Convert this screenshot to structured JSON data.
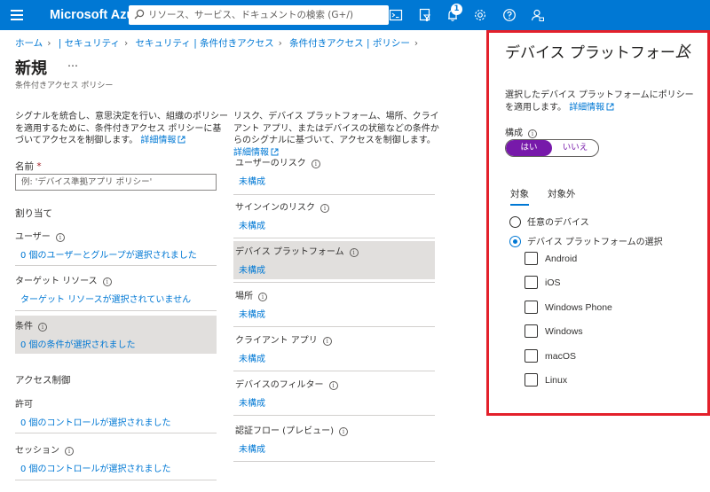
{
  "topbar": {
    "brand": "Microsoft Azure",
    "search_placeholder": "リソース、サービス、ドキュメントの検索 (G+/)",
    "notification_count": "1"
  },
  "breadcrumb": [
    "ホーム",
    "| セキュリティ",
    "セキュリティ | 条件付きアクセス",
    "条件付きアクセス | ポリシー"
  ],
  "page": {
    "title": "新規",
    "more": "…",
    "subtitle": "条件付きアクセス ポリシー"
  },
  "left": {
    "intro_text": "シグナルを統合し、意思決定を行い、組織のポリシーを適用するために、条件付きアクセス ポリシーに基づいてアクセスを制御します。",
    "intro_link": "詳細情報",
    "name_label": "名前",
    "name_required": "*",
    "name_placeholder": "例: 'デバイス準拠アプリ ポリシー'",
    "assignments_head": "割り当て",
    "users_label": "ユーザー",
    "users_value": "0 個のユーザーとグループが選択されました",
    "target_label": "ターゲット リソース",
    "target_value": "ターゲット リソースが選択されていません",
    "conditions_label": "条件",
    "conditions_value": "0 個の条件が選択されました",
    "access_head": "アクセス制御",
    "grant_label": "許可",
    "grant_value": "0 個のコントロールが選択されました",
    "session_label": "セッション",
    "session_value": "0 個のコントロールが選択されました"
  },
  "middle": {
    "intro_text": "リスク、デバイス プラットフォーム、場所、クライアント アプリ、またはデバイスの状態などの条件からのシグナルに基づいて、アクセスを制御します。",
    "intro_link": "詳細情報",
    "items": [
      {
        "label": "ユーザーのリスク",
        "value": "未構成"
      },
      {
        "label": "サインインのリスク",
        "value": "未構成"
      },
      {
        "label": "デバイス プラットフォーム",
        "value": "未構成"
      },
      {
        "label": "場所",
        "value": "未構成"
      },
      {
        "label": "クライアント アプリ",
        "value": "未構成"
      },
      {
        "label": "デバイスのフィルター",
        "value": "未構成"
      },
      {
        "label": "認証フロー (プレビュー)",
        "value": "未構成"
      }
    ]
  },
  "panel": {
    "title": "デバイス プラットフォーム",
    "description": "選択したデバイス プラットフォームにポリシーを適用します。",
    "link": "詳細情報",
    "configure_label": "構成",
    "toggle_on": "はい",
    "toggle_off": "いいえ",
    "tab_include": "対象",
    "tab_exclude": "対象外",
    "radio_any": "任意のデバイス",
    "radio_select": "デバイス プラットフォームの選択",
    "platforms": [
      "Android",
      "iOS",
      "Windows Phone",
      "Windows",
      "macOS",
      "Linux"
    ]
  },
  "colors": {
    "topbar": "#0078d4",
    "link": "#0078d4",
    "toggle_on": "#7719aa",
    "highlight_border": "#e3202b",
    "selected_row": "#e1dfdd"
  }
}
